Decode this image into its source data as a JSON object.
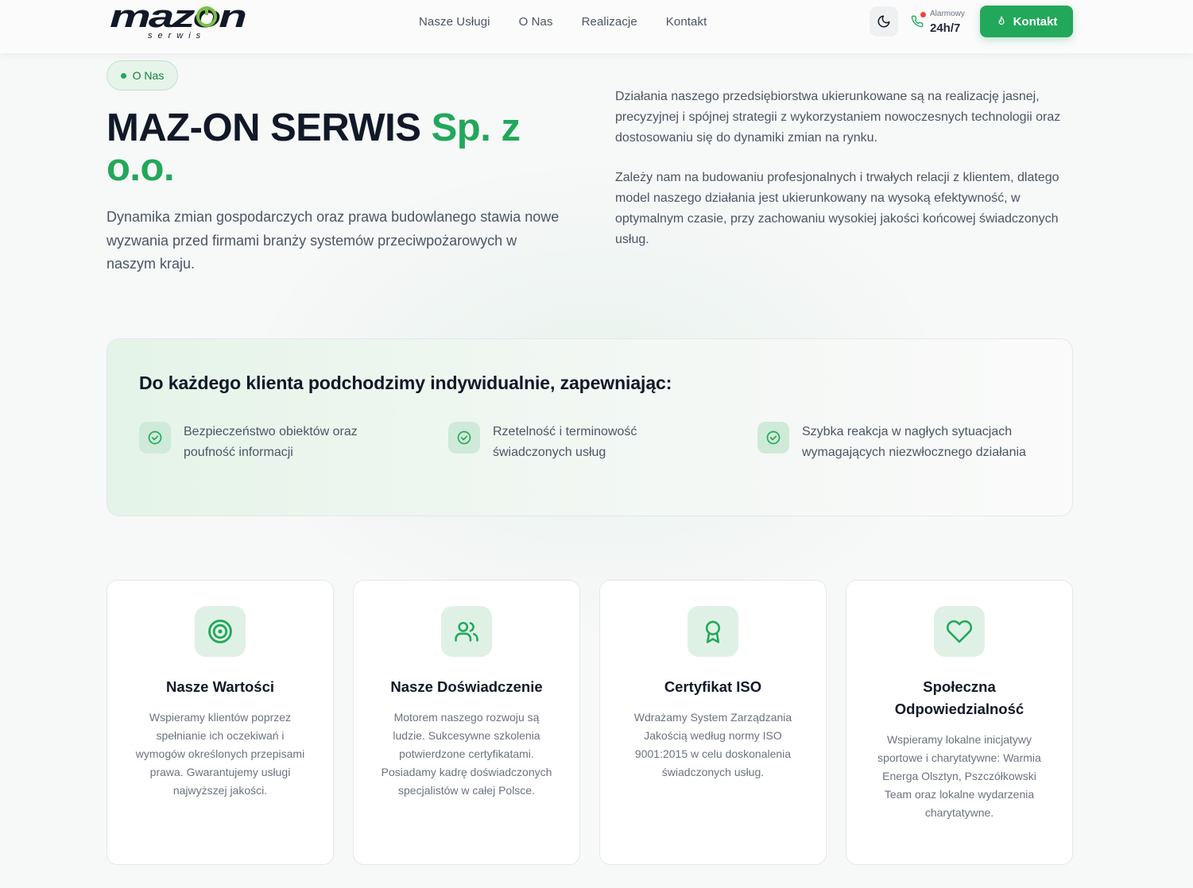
{
  "header": {
    "logo_text": "mazon",
    "logo_subtext": "serwis",
    "nav": [
      "Nasze Usługi",
      "O Nas",
      "Realizacje",
      "Kontakt"
    ],
    "theme_icon": "moon-icon",
    "alarm": {
      "label": "Alarmowy",
      "value": "24h/7",
      "icon": "phone-icon"
    },
    "contact_button": {
      "label": "Kontakt",
      "icon": "flame-icon"
    }
  },
  "hero": {
    "badge": "O Nas",
    "title_main": "MAZ-ON SERWIS",
    "title_accent": "Sp. z o.o.",
    "lead": "Dynamika zmian gospodarczych oraz prawa budowlanego stawia nowe wyzwania przed firmami branży systemów przeciwpożarowych w naszym kraju.",
    "paragraphs": [
      "Działania naszego przedsiębiorstwa ukierunkowane są na realizację jasnej, precyzyjnej i spójnej strategii z wykorzystaniem nowoczesnych technologii oraz dostosowaniu się do dynamiki zmian na rynku.",
      "Zależy nam na budowaniu profesjonalnych i trwałych relacji z klientem, dlatego model naszego działania jest ukierunkowany na wysoką efektywność, w optymalnym czasie, przy zachowaniu wysokiej jakości końcowej świadczonych usług."
    ]
  },
  "approach": {
    "title": "Do każdego klienta podchodzimy indywidualnie, zapewniając:",
    "items": [
      "Bezpieczeństwo obiektów oraz poufność informacji",
      "Rzetelność i terminowość świadczonych usług",
      "Szybka reakcja w nagłych sytuacjach wymagających niezwłocznego działania"
    ]
  },
  "cards": [
    {
      "icon": "target-icon",
      "title": "Nasze Wartości",
      "text": "Wspieramy klientów poprzez spełnianie ich oczekiwań i wymogów określonych przepisami prawa. Gwarantujemy usługi najwyższej jakości."
    },
    {
      "icon": "users-icon",
      "title": "Nasze Doświadczenie",
      "text": "Motorem naszego rozwoju są ludzie. Sukcesywne szkolenia potwierdzone certyfikatami. Posiadamy kadrę doświadczonych specjalistów w całej Polsce."
    },
    {
      "icon": "award-icon",
      "title": "Certyfikat ISO",
      "text": "Wdrażamy System Zarządzania Jakością według normy ISO 9001:2015 w celu doskonalenia świadczonych usług."
    },
    {
      "icon": "heart-icon",
      "title": "Społeczna Odpowiedzialność",
      "text": "Wspieramy lokalne inicjatywy sportowe i charytatywne: Warmia Energa Olsztyn, Pszczółkowski Team oraz lokalne wydarzenia charytatywne."
    }
  ],
  "colors": {
    "accent": "#22a85a",
    "text_dark": "#111827",
    "text_muted": "#4b5563",
    "alarm_dot": "#ef4444"
  }
}
